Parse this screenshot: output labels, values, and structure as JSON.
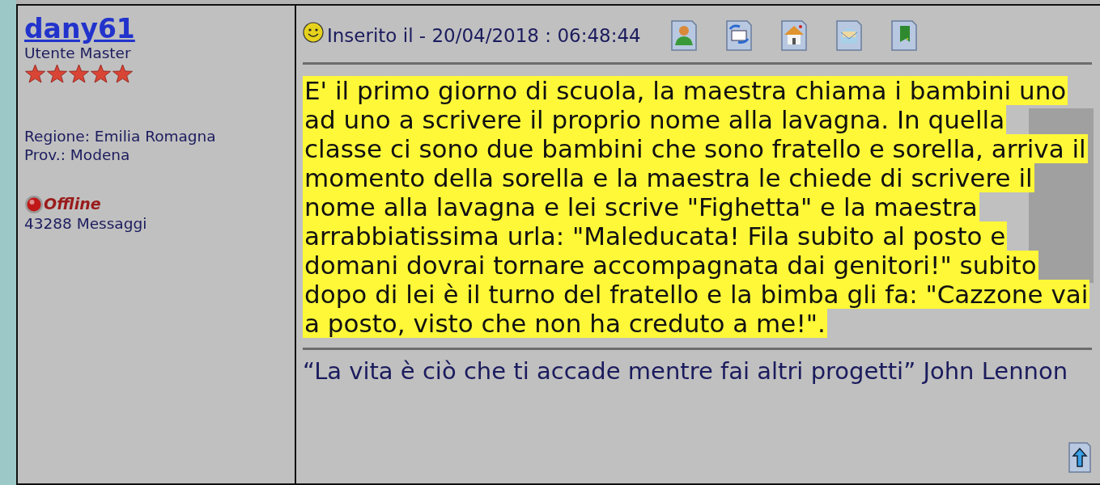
{
  "author": {
    "username": "dany61",
    "rank": "Utente Master",
    "stars": 5,
    "region": "Regione: Emilia Romagna",
    "province": "Prov.: Modena",
    "status": "Offline",
    "online": false,
    "messages": "43288 Messaggi"
  },
  "post": {
    "posted": "Inserito il - 20/04/2018 : 06:48:44",
    "actions": [
      {
        "kind": "profile"
      },
      {
        "kind": "send"
      },
      {
        "kind": "home"
      },
      {
        "kind": "message"
      },
      {
        "kind": "bookmark"
      }
    ],
    "body": "E' il primo giorno di scuola, la maestra chiama i bambini uno ad uno a scrivere il proprio nome alla lavagna. In quella classe ci sono due bambini che sono fratello e sorella, arriva il momento della sorella e la maestra le chiede di scrivere il nome alla lavagna e lei scrive \"Fighetta\" e la maestra arrabbiatissima urla: \"Maleducata! Fila subito al posto e domani dovrai tornare accompagnata dai genitori!\" subito dopo di lei è il turno del fratello e la bimba gli fa: \"Cazzone vai a posto, visto che non ha creduto a me!\".",
    "signature": "“La vita è ciò che ti accade mentre fai altri progetti” John Lennon"
  }
}
